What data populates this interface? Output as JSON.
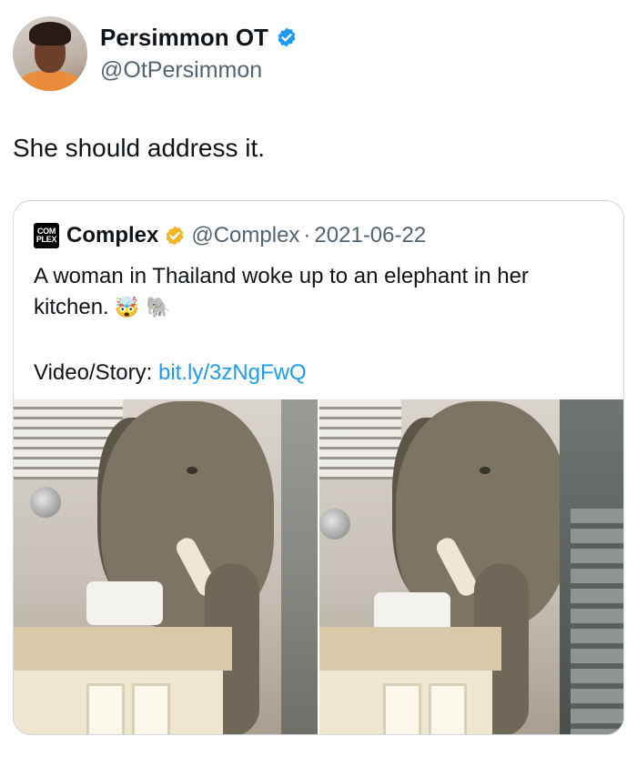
{
  "author": {
    "display_name": "Persimmon OT",
    "handle": "@OtPersimmon",
    "verified": true,
    "avatar_icon": "avatar"
  },
  "tweet": {
    "text": "She should address it."
  },
  "quoted_tweet": {
    "logo_lines": [
      "COM",
      "PLEX"
    ],
    "display_name": "Complex",
    "verified_badge_color": "#f2b627",
    "handle": "@Complex",
    "separator": "·",
    "date": "2021-06-22",
    "text": "A woman in Thailand woke up to an elephant in her kitchen.",
    "emojis": "🤯 🐘",
    "story_label": "Video/Story:",
    "story_link": "bit.ly/3zNgFwQ",
    "media": [
      {
        "icon": "video-frame-elephant-kitchen-1"
      },
      {
        "icon": "video-frame-elephant-kitchen-2"
      }
    ]
  },
  "colors": {
    "text": "#0f1419",
    "secondary": "#536471",
    "link": "#1d9bf0",
    "border": "#cfd9de",
    "blue_verified": "#1d9bf0"
  }
}
